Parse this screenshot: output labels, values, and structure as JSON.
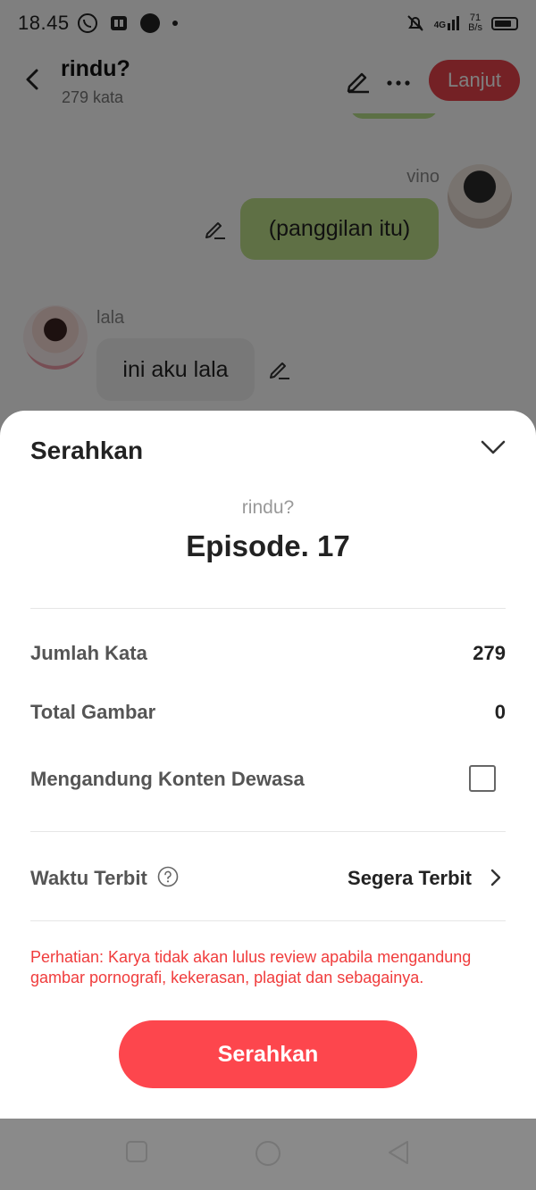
{
  "status_bar": {
    "time": "18.45",
    "net_speed_value": "71",
    "net_speed_unit": "B/s",
    "signal_label": "4G"
  },
  "header": {
    "title": "rindu?",
    "word_count": "279 kata",
    "next_label": "Lanjut"
  },
  "chat": {
    "messages": [
      {
        "sender": "vino",
        "text": "(panggilan itu)",
        "side": "right"
      },
      {
        "sender": "lala",
        "text": "ini aku lala",
        "side": "left"
      }
    ]
  },
  "sheet": {
    "title": "Serahkan",
    "story_name": "rindu?",
    "episode": "Episode. 17",
    "rows": {
      "word_count": {
        "label": "Jumlah Kata",
        "value": "279"
      },
      "image_total": {
        "label": "Total Gambar",
        "value": "0"
      },
      "adult_content": {
        "label": "Mengandung Konten Dewasa",
        "checked": false
      },
      "publish_time": {
        "label": "Waktu Terbit",
        "value": "Segera Terbit"
      }
    },
    "warning": "Perhatian: Karya tidak akan lulus review apabila mengandung gambar pornografi, kekerasan, plagiat dan sebagainya.",
    "submit_label": "Serahkan"
  },
  "colors": {
    "accent": "#fd464d",
    "warning_text": "#f03c3c",
    "bubble_right": "#bfe18b",
    "bubble_left": "#f0f0f0"
  },
  "icons": {
    "back": "chevron-left-icon",
    "edit": "pencil-icon",
    "more": "more-horizontal-icon",
    "collapse": "chevron-down-icon",
    "help": "question-circle-icon",
    "go": "chevron-right-icon"
  }
}
